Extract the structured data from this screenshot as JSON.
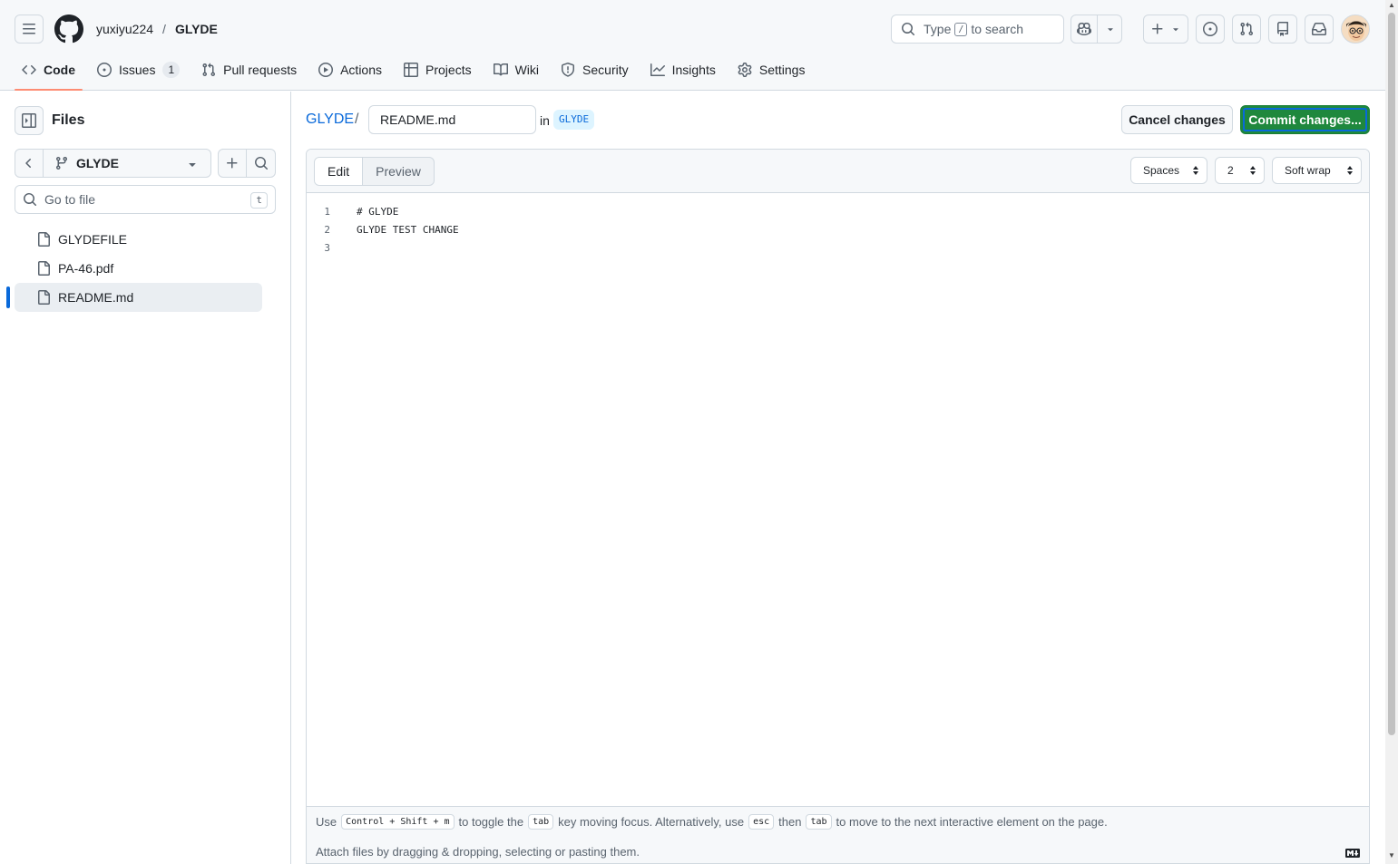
{
  "header": {
    "owner": "yuxiyu224",
    "separator": "/",
    "repo": "GLYDE",
    "search": {
      "pre": "Type",
      "key": "/",
      "post": "to search"
    }
  },
  "nav": {
    "code": "Code",
    "issues": "Issues",
    "issues_count": "1",
    "pulls": "Pull requests",
    "actions": "Actions",
    "projects": "Projects",
    "wiki": "Wiki",
    "security": "Security",
    "insights": "Insights",
    "settings": "Settings"
  },
  "sidebar": {
    "title": "Files",
    "branch": "GLYDE",
    "goto_placeholder": "Go to file",
    "goto_key": "t",
    "files": [
      "GLYDEFILE",
      "PA-46.pdf",
      "README.md"
    ]
  },
  "editor_header": {
    "repo": "GLYDE",
    "slash": "/",
    "filename": "README.md",
    "in": "in",
    "branch": "GLYDE",
    "cancel": "Cancel changes",
    "commit": "Commit changes..."
  },
  "editor": {
    "tab_edit": "Edit",
    "tab_preview": "Preview",
    "indent_mode": "Spaces",
    "indent_size": "2",
    "wrap_mode": "Soft wrap",
    "lines": [
      {
        "n": "1",
        "text": "# GLYDE"
      },
      {
        "n": "2",
        "text": "GLYDE TEST CHANGE"
      },
      {
        "n": "3",
        "text": ""
      }
    ]
  },
  "footer": {
    "hint": {
      "use": "Use",
      "keys": "Control + Shift + m",
      "toggle": "to toggle the",
      "tab": "tab",
      "moving": "key moving focus. Alternatively, use",
      "esc": "esc",
      "then": "then",
      "tab2": "tab",
      "move": "to move to the next interactive element on the page."
    },
    "attach": "Attach files by dragging & dropping, selecting or pasting them."
  }
}
